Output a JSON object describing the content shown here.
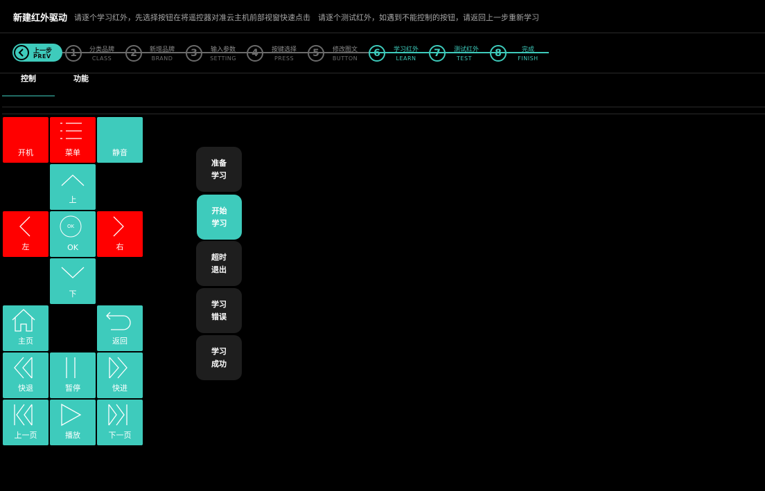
{
  "header": {
    "title": "新建红外驱动",
    "hint": "请逐个学习红外，先选择按钮在将遥控器对准云主机前部视窗快速点击　请逐个测试红外，如遇到不能控制的按钮，请返回上一步重新学习"
  },
  "stepper": {
    "prev": {
      "cn": "上一步",
      "en": "PREV"
    },
    "steps": [
      {
        "num": "1",
        "cn": "分类品牌",
        "en": "CLASS",
        "active": false
      },
      {
        "num": "2",
        "cn": "新增品牌",
        "en": "BRAND",
        "active": false
      },
      {
        "num": "3",
        "cn": "输入参数",
        "en": "SETTING",
        "active": false
      },
      {
        "num": "4",
        "cn": "按键选择",
        "en": "PRESS",
        "active": false
      },
      {
        "num": "5",
        "cn": "修改图文",
        "en": "BUTTON",
        "active": false
      },
      {
        "num": "6",
        "cn": "学习红外",
        "en": "LEARN",
        "active": true
      },
      {
        "num": "7",
        "cn": "测试红外",
        "en": "TEST",
        "active": true
      },
      {
        "num": "8",
        "cn": "完成",
        "en": "FINISH",
        "active": true
      }
    ],
    "accent_color": "#3ecbbc",
    "inactive_color": "#6b6b6b"
  },
  "tabs": [
    {
      "label": "控制",
      "active": true
    },
    {
      "label": "功能",
      "active": false
    }
  ],
  "keys": {
    "power": "开机",
    "menu": "菜单",
    "mute": "静音",
    "up": "上",
    "left": "左",
    "ok": "OK",
    "ok_inner": "OK",
    "right": "右",
    "down": "下",
    "home": "主页",
    "back": "返回",
    "rewind": "快退",
    "pause": "暂停",
    "forward": "快进",
    "prev_page": "上一页",
    "play": "播放",
    "next_page": "下一页"
  },
  "status": [
    {
      "line1": "准备",
      "line2": "学习",
      "active": false
    },
    {
      "line1": "开始",
      "line2": "学习",
      "active": true
    },
    {
      "line1": "超时",
      "line2": "退出",
      "active": false
    },
    {
      "line1": "学习",
      "line2": "错误",
      "active": false
    },
    {
      "line1": "学习",
      "line2": "成功",
      "active": false
    }
  ],
  "colors": {
    "teal": "#3ecbbc",
    "red": "#ff0000",
    "dark_button": "#1e1e1e"
  }
}
